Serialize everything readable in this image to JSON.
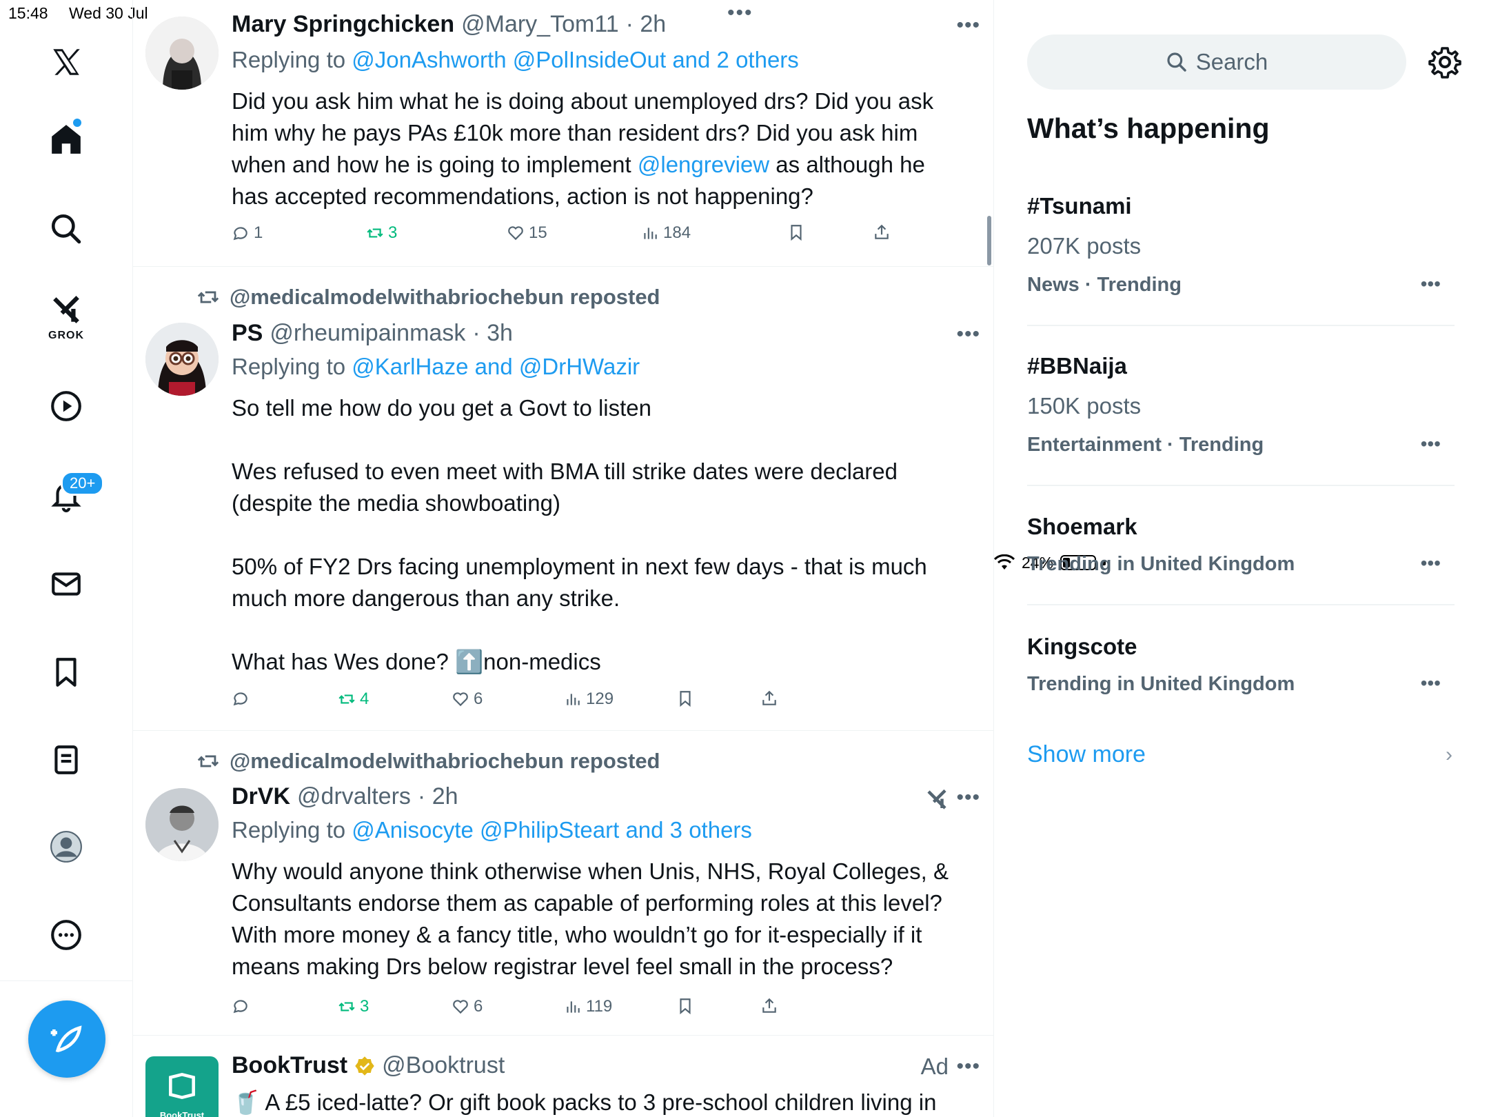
{
  "status_bar": {
    "time": "15:48",
    "date": "Wed 30 Jul",
    "battery": "24%"
  },
  "nav": {
    "grok_label": "GROK",
    "notification_count": "20+"
  },
  "colors": {
    "accent": "#1d9bf0",
    "repost_green": "#00ba7c",
    "secondary_text": "#536471"
  },
  "tweets": [
    {
      "name": "Mary Springchicken",
      "handle": "@Mary_Tom11",
      "time": "· 2h",
      "reply_prefix": "Replying to",
      "reply_to": "@JonAshworth @PolInsideOut and 2 others",
      "body_before": "Did you ask him what he is doing about unemployed drs?  Did you ask him why he pays PAs £10k more than resident drs?  Did you ask him when and how he is going to implement ",
      "body_mention": "@lengreview",
      "body_after": " as although he has accepted recommendations, action is not happening?",
      "replies": "1",
      "reposts": "3",
      "likes": "15",
      "views": "184"
    },
    {
      "reposted_by": "@medicalmodelwithabriochebun reposted",
      "name": "PS",
      "handle": "@rheumipainmask",
      "time": "· 3h",
      "reply_prefix": "Replying to",
      "reply_to": "@KarlHaze and @DrHWazir",
      "paragraphs": [
        "So tell me how do you get a Govt to listen",
        "Wes refused to even meet with BMA till strike dates were declared (despite the media showboating)",
        "50% of FY2 Drs facing unemployment in next few days - that is much much more dangerous than any strike.",
        "What has Wes done? ⬆️non-medics"
      ],
      "replies": "",
      "reposts": "4",
      "likes": "6",
      "views": "129"
    },
    {
      "reposted_by": "@medicalmodelwithabriochebun reposted",
      "name": "DrVK",
      "handle": "@drvalters",
      "time": "· 2h",
      "reply_prefix": "Replying to",
      "reply_to": "@Anisocyte @PhilipSteart and 3 others",
      "body": "Why would anyone think otherwise when Unis, NHS, Royal Colleges, & Consultants endorse them as capable of performing roles at this level? With more money & a fancy title, who wouldn’t go for it-especially if it means making Drs below registrar level feel small in the process?",
      "replies": "",
      "reposts": "3",
      "likes": "6",
      "views": "119"
    },
    {
      "name": "BookTrust",
      "handle": "@Booktrust",
      "ad_label": "Ad",
      "body": "🥤 A £5 iced-latte? Or gift book packs to 3 pre-school children living in",
      "avatar_text": "BookTrust"
    }
  ],
  "sidebar": {
    "search_placeholder": "Search",
    "title": "What’s happening",
    "trends": [
      {
        "name": "#Tsunami",
        "posts": "207K posts",
        "meta": "News · Trending"
      },
      {
        "name": "#BBNaija",
        "posts": "150K posts",
        "meta": "Entertainment · Trending"
      },
      {
        "name": "Shoemark",
        "posts": "",
        "meta": "Trending in United Kingdom"
      },
      {
        "name": "Kingscote",
        "posts": "",
        "meta": "Trending in United Kingdom"
      }
    ],
    "show_more": "Show more"
  }
}
